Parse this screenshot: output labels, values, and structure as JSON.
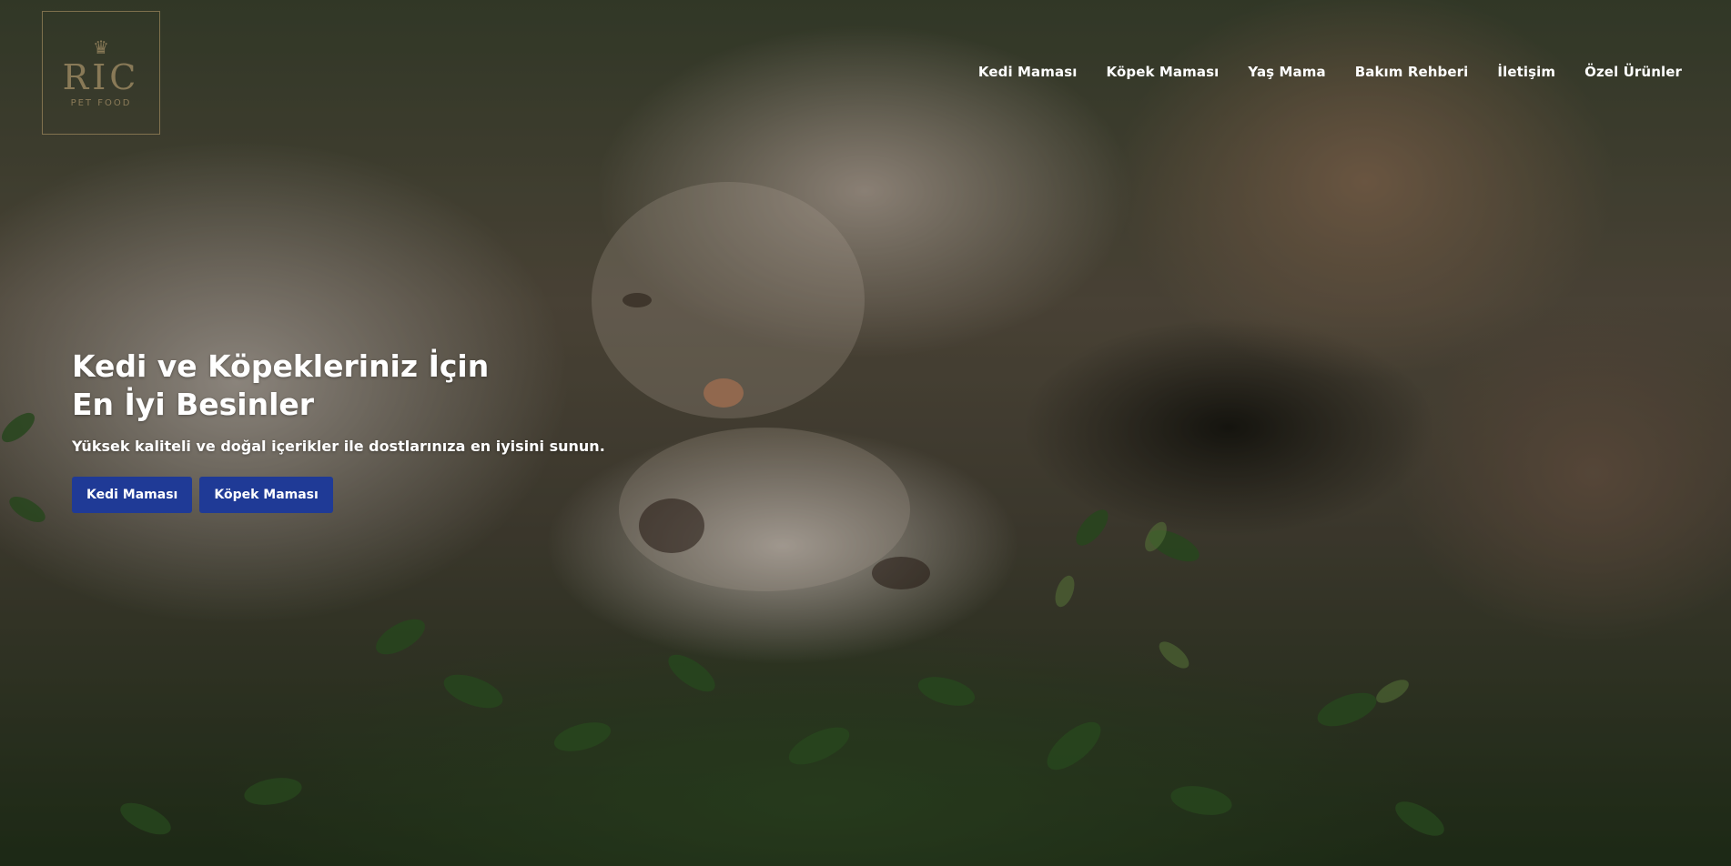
{
  "brand": {
    "logo_text": "RIC",
    "logo_subtext": "PET FOOD"
  },
  "nav": {
    "items": [
      {
        "label": "Kedi Maması"
      },
      {
        "label": "Köpek Maması"
      },
      {
        "label": "Yaş Mama"
      },
      {
        "label": "Bakım Rehberi"
      },
      {
        "label": "İletişim"
      },
      {
        "label": "Özel Ürünler"
      }
    ]
  },
  "hero": {
    "headline_line1": "Kedi ve Köpekleriniz İçin",
    "headline_line2": "En İyi Besinler",
    "subtitle": "Yüksek kaliteli ve doğal içerikler ile dostlarınıza en iyisini sunun.",
    "buttons": [
      {
        "label": "Kedi Maması"
      },
      {
        "label": "Köpek Maması"
      }
    ]
  },
  "colors": {
    "button_bg": "#1f3a96",
    "nav_text": "#ffffff",
    "logo_gold": "#cdaf7d"
  },
  "background_image": "cat and dog lying together on green leaves"
}
